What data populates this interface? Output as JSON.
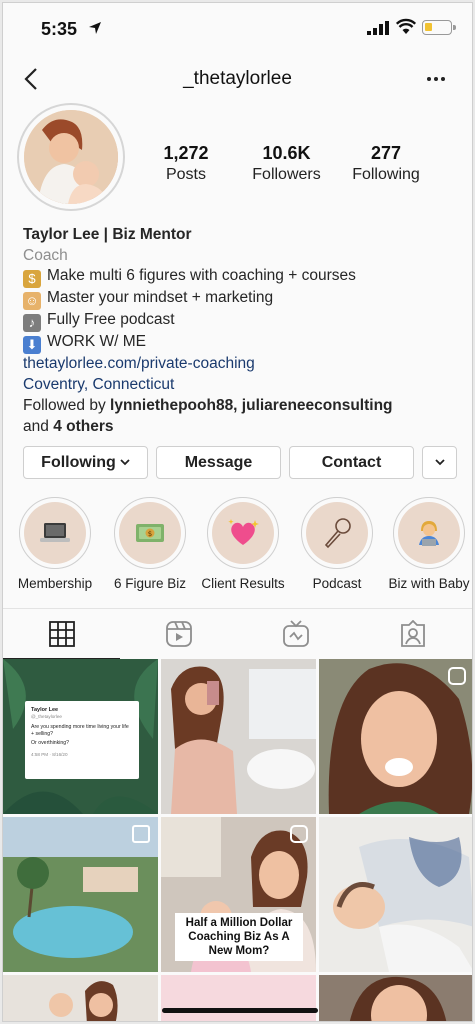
{
  "status_bar": {
    "time": "5:35"
  },
  "nav": {
    "username": "_thetaylorlee"
  },
  "profile": {
    "stats": [
      {
        "value": "1,272",
        "label": "Posts"
      },
      {
        "value": "10.6K",
        "label": "Followers"
      },
      {
        "value": "277",
        "label": "Following"
      }
    ],
    "name": "Taylor Lee | Biz Mentor",
    "category": "Coach",
    "bio_lines": [
      {
        "icon": "money-bag-icon",
        "text": "Make multi 6 figures with coaching + courses"
      },
      {
        "icon": "person-meditating-icon",
        "text": "Master your mindset + marketing"
      },
      {
        "icon": "microphone-icon",
        "text": "Fully Free podcast"
      },
      {
        "icon": "down-arrow-icon",
        "text": "WORK W/ ME"
      }
    ],
    "website": "thetaylorlee.com/private-coaching",
    "location": "Coventry, Connecticut",
    "followed_by_prefix": "Followed by",
    "followed_by_users": "lynniethepooh88, juliareneeconsulting",
    "followed_by_and": "and",
    "followed_by_others": "4 others"
  },
  "buttons": {
    "following": "Following",
    "message": "Message",
    "contact": "Contact"
  },
  "highlights": [
    {
      "label": "Membership",
      "icon": "laptop-icon"
    },
    {
      "label": "6 Figure Biz",
      "icon": "dollar-bills-icon"
    },
    {
      "label": "Client Results",
      "icon": "sparkling-heart-icon"
    },
    {
      "label": "Podcast",
      "icon": "microphone-icon"
    },
    {
      "label": "Biz with Baby",
      "icon": "person-with-laptop-icon"
    }
  ],
  "grid": {
    "post1_card": {
      "name": "Taylor Lee",
      "handle": "@_thetaylorlee",
      "line1": "Are you spending more time living your life + selling?",
      "line2": "Or overthinking?",
      "meta": "4:58 PM · 8/16/20"
    },
    "post5_overlay": "Half a Million Dollar Coaching Biz As A New Mom?"
  },
  "colors": {
    "link": "#1a3a6e",
    "muted": "#8e8e8e",
    "highlight_bg": "#ead8cb"
  }
}
